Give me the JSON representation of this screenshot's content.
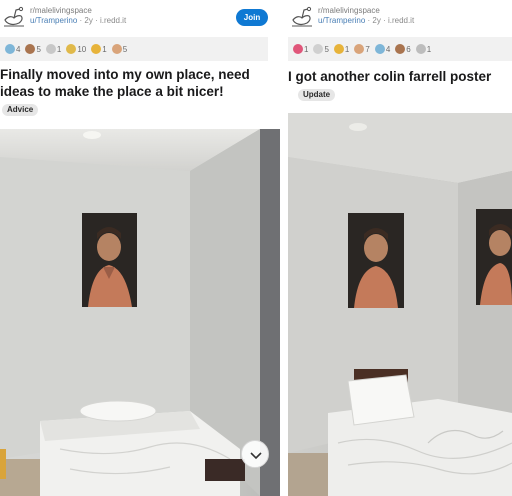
{
  "left_post": {
    "subreddit": "r/malelivingspace",
    "user": "u/Tramperino",
    "meta": " · 2y · i.redd.it",
    "join_label": "Join",
    "awards": [
      {
        "icon": "helpful-award-icon",
        "count": "4",
        "color": "#7eb6d8"
      },
      {
        "icon": "bear-award-icon",
        "count": "5",
        "color": "#a9744f"
      },
      {
        "icon": "eyes-award-icon",
        "count": "1",
        "color": "#c8c8c8"
      },
      {
        "icon": "smile-award-icon",
        "count": "10",
        "color": "#e0b94a"
      },
      {
        "icon": "gold-award-icon",
        "count": "1",
        "color": "#e7b33a"
      },
      {
        "icon": "shocked-award-icon",
        "count": "5",
        "color": "#d9a47a"
      }
    ],
    "title": "Finally moved into my own place, need ideas to make the place a bit nicer!",
    "flair": "Advice"
  },
  "right_post": {
    "subreddit": "r/malelivingspace",
    "user": "u/Tramperino",
    "meta": " · 2y · i.redd.it",
    "awards": [
      {
        "icon": "heart-award-icon",
        "count": "1",
        "color": "#e0567a"
      },
      {
        "icon": "smile-award-icon",
        "count": "5",
        "color": "#d0d0d0"
      },
      {
        "icon": "gold-award-icon",
        "count": "1",
        "color": "#e7b33a"
      },
      {
        "icon": "shocked-award-icon",
        "count": "7",
        "color": "#d9a47a"
      },
      {
        "icon": "helpful-award-icon",
        "count": "4",
        "color": "#7eb6d8"
      },
      {
        "icon": "bear-award-icon",
        "count": "6",
        "color": "#a9744f"
      },
      {
        "icon": "wholesome-award-icon",
        "count": "1",
        "color": "#bdbdbd"
      }
    ],
    "title": "I got another colin farrell poster",
    "flair": "Update"
  },
  "colors": {
    "join": "#0f79d3",
    "link": "#4a7fb5",
    "award_bar": "#f1f1f1"
  }
}
